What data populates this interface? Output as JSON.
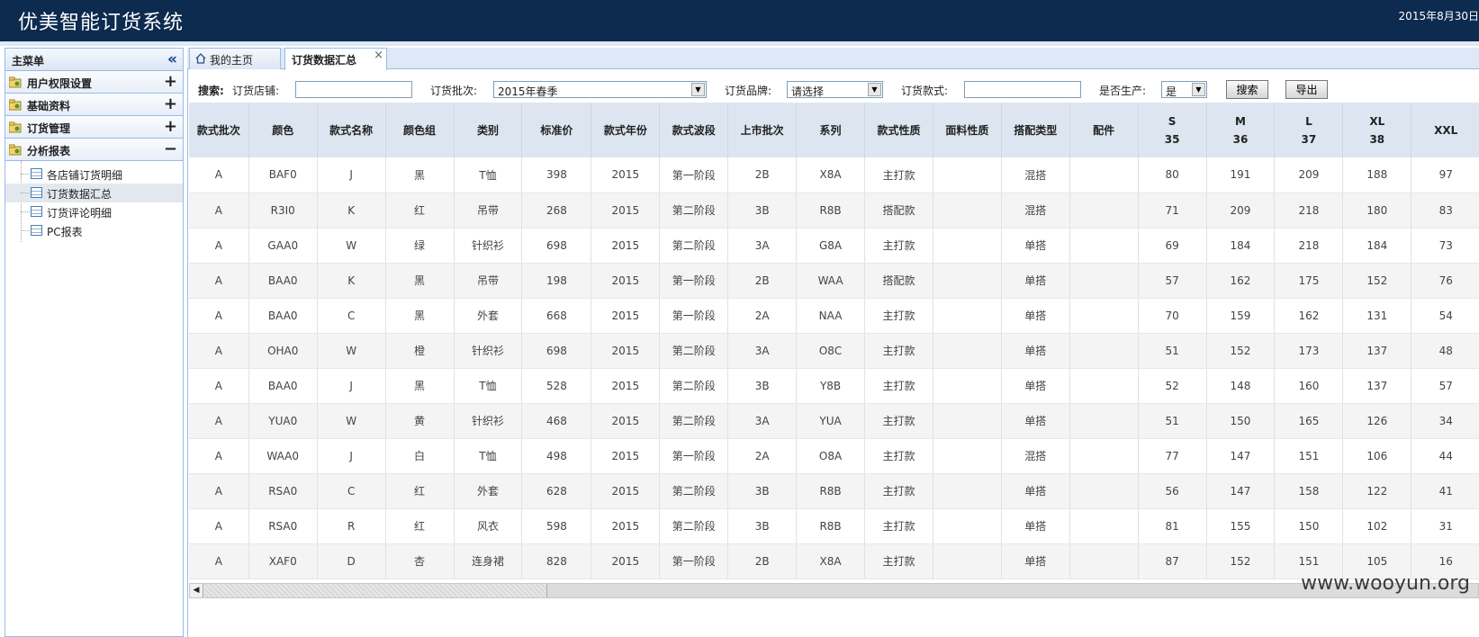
{
  "app": {
    "title": "优美智能订货系统",
    "date": "2015年8月30日"
  },
  "sidebar": {
    "title": "主菜单",
    "groups": [
      {
        "label": "用户权限设置",
        "toggle": "+"
      },
      {
        "label": "基础资料",
        "toggle": "+"
      },
      {
        "label": "订货管理",
        "toggle": "+"
      },
      {
        "label": "分析报表",
        "toggle": "−"
      }
    ],
    "items": [
      {
        "label": "各店铺订货明细"
      },
      {
        "label": "订货数据汇总"
      },
      {
        "label": "订货评论明细"
      },
      {
        "label": "PC报表"
      }
    ]
  },
  "tabs": [
    {
      "label": "我的主页"
    },
    {
      "label": "订货数据汇总",
      "close": "×"
    }
  ],
  "search": {
    "title": "搜索:",
    "store_label": "订货店铺:",
    "store_value": "",
    "batch_label": "订货批次:",
    "batch_value": "2015年春季",
    "brand_label": "订货品牌:",
    "brand_value": "请选择",
    "style_label": "订货款式:",
    "style_value": "",
    "produce_label": "是否生产:",
    "produce_value": "是",
    "search_button": "搜索",
    "export_button": "导出"
  },
  "table": {
    "columns": [
      "款式批次",
      "颜色",
      "款式名称",
      "颜色组",
      "类别",
      "标准价",
      "款式年份",
      "款式波段",
      "上市批次",
      "系列",
      "款式性质",
      "面料性质",
      "搭配类型",
      "配件"
    ],
    "size_columns": [
      {
        "size": "S",
        "code": "35"
      },
      {
        "size": "M",
        "code": "36"
      },
      {
        "size": "L",
        "code": "37"
      },
      {
        "size": "XL",
        "code": "38"
      },
      {
        "size": "XXL",
        "code": ""
      }
    ],
    "rows": [
      [
        "A",
        "BAF0",
        "J",
        "黑",
        "T恤",
        "398",
        "2015",
        "第一阶段",
        "2B",
        "X8A",
        "主打款",
        "",
        "混搭",
        "",
        "80",
        "191",
        "209",
        "188",
        "97"
      ],
      [
        "A",
        "R3I0",
        "K",
        "红",
        "吊带",
        "268",
        "2015",
        "第二阶段",
        "3B",
        "R8B",
        "搭配款",
        "",
        "混搭",
        "",
        "71",
        "209",
        "218",
        "180",
        "83"
      ],
      [
        "A",
        "GAA0",
        "W",
        "绿",
        "针织衫",
        "698",
        "2015",
        "第二阶段",
        "3A",
        "G8A",
        "主打款",
        "",
        "单搭",
        "",
        "69",
        "184",
        "218",
        "184",
        "73"
      ],
      [
        "A",
        "BAA0",
        "K",
        "黑",
        "吊带",
        "198",
        "2015",
        "第一阶段",
        "2B",
        "WAA",
        "搭配款",
        "",
        "单搭",
        "",
        "57",
        "162",
        "175",
        "152",
        "76"
      ],
      [
        "A",
        "BAA0",
        "C",
        "黑",
        "外套",
        "668",
        "2015",
        "第一阶段",
        "2A",
        "NAA",
        "主打款",
        "",
        "单搭",
        "",
        "70",
        "159",
        "162",
        "131",
        "54"
      ],
      [
        "A",
        "OHA0",
        "W",
        "橙",
        "针织衫",
        "698",
        "2015",
        "第二阶段",
        "3A",
        "O8C",
        "主打款",
        "",
        "单搭",
        "",
        "51",
        "152",
        "173",
        "137",
        "48"
      ],
      [
        "A",
        "BAA0",
        "J",
        "黑",
        "T恤",
        "528",
        "2015",
        "第二阶段",
        "3B",
        "Y8B",
        "主打款",
        "",
        "单搭",
        "",
        "52",
        "148",
        "160",
        "137",
        "57"
      ],
      [
        "A",
        "YUA0",
        "W",
        "黄",
        "针织衫",
        "468",
        "2015",
        "第二阶段",
        "3A",
        "YUA",
        "主打款",
        "",
        "单搭",
        "",
        "51",
        "150",
        "165",
        "126",
        "34"
      ],
      [
        "A",
        "WAA0",
        "J",
        "白",
        "T恤",
        "498",
        "2015",
        "第一阶段",
        "2A",
        "O8A",
        "主打款",
        "",
        "混搭",
        "",
        "77",
        "147",
        "151",
        "106",
        "44"
      ],
      [
        "A",
        "RSA0",
        "C",
        "红",
        "外套",
        "628",
        "2015",
        "第二阶段",
        "3B",
        "R8B",
        "主打款",
        "",
        "单搭",
        "",
        "56",
        "147",
        "158",
        "122",
        "41"
      ],
      [
        "A",
        "RSA0",
        "R",
        "红",
        "风衣",
        "598",
        "2015",
        "第二阶段",
        "3B",
        "R8B",
        "主打款",
        "",
        "单搭",
        "",
        "81",
        "155",
        "150",
        "102",
        "31"
      ],
      [
        "A",
        "XAF0",
        "D",
        "杏",
        "连身裙",
        "828",
        "2015",
        "第一阶段",
        "2B",
        "X8A",
        "主打款",
        "",
        "单搭",
        "",
        "87",
        "152",
        "151",
        "105",
        "16"
      ]
    ]
  },
  "watermark": "www.wooyun.org",
  "colors": {
    "topbar": "#0d2a4f",
    "panel_border": "#99bbe8",
    "header_bg": "#dde6f0"
  },
  "icons": {
    "collapse": "double-chevron-left-icon",
    "group": "folder-key-icon",
    "item": "report-grid-icon",
    "home": "home-icon",
    "close": "close-icon",
    "dropdown": "dropdown-arrow-icon"
  }
}
